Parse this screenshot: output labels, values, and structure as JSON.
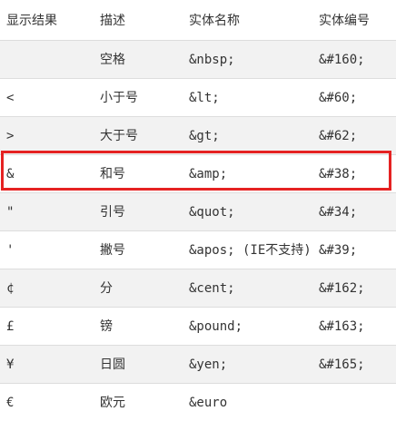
{
  "table": {
    "headers": [
      "显示结果",
      "描述",
      "实体名称",
      "实体编号"
    ],
    "rows": [
      {
        "result": "",
        "desc": "空格",
        "name": "&nbsp;",
        "number": "&#160;"
      },
      {
        "result": "<",
        "desc": "小于号",
        "name": "&lt;",
        "number": "&#60;"
      },
      {
        "result": ">",
        "desc": "大于号",
        "name": "&gt;",
        "number": "&#62;"
      },
      {
        "result": "&",
        "desc": "和号",
        "name": "&amp;",
        "number": "&#38;"
      },
      {
        "result": "\"",
        "desc": "引号",
        "name": "&quot;",
        "number": "&#34;"
      },
      {
        "result": "'",
        "desc": "撇号",
        "name": "&apos; (IE不支持)",
        "number": "&#39;"
      },
      {
        "result": "¢",
        "desc": "分",
        "name": "&cent;",
        "number": "&#162;"
      },
      {
        "result": "£",
        "desc": "镑",
        "name": "&pound;",
        "number": "&#163;"
      },
      {
        "result": "¥",
        "desc": "日圆",
        "name": "&yen;",
        "number": "&#165;"
      },
      {
        "result": "€",
        "desc": "欧元",
        "name": "&euro",
        "number": ""
      }
    ]
  },
  "highlight": {
    "row": "&",
    "color": "#e52222"
  },
  "colors": {
    "stripe": "#f2f2f2",
    "border": "#dddddd",
    "text": "#333333"
  }
}
